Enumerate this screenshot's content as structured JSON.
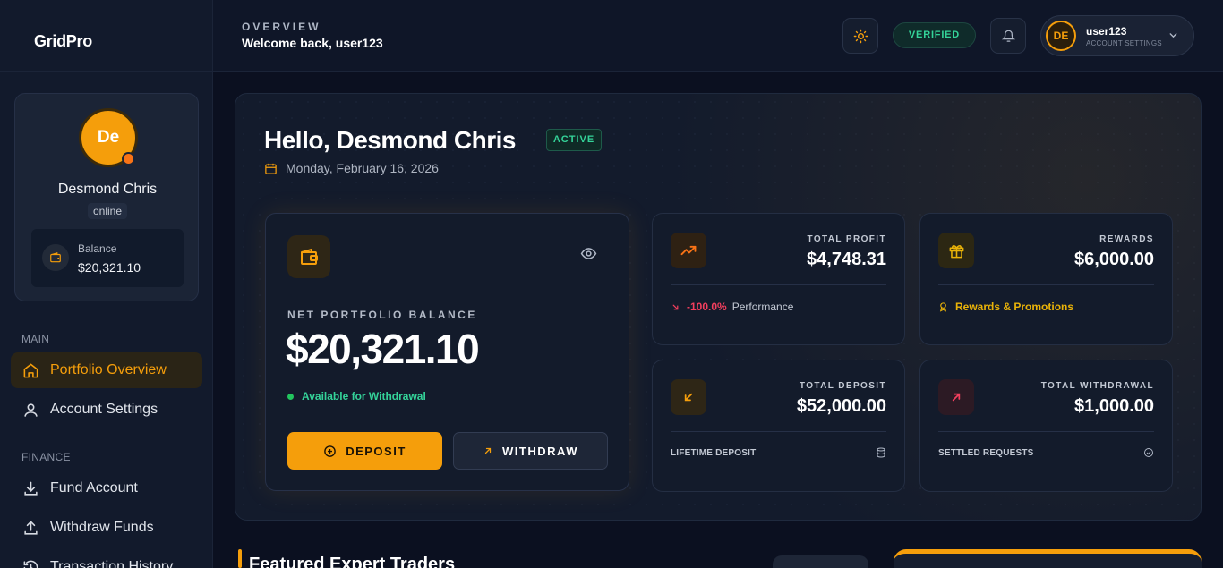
{
  "app": {
    "logo": "GridPro"
  },
  "header": {
    "kicker": "OVERVIEW",
    "welcome": "Welcome back, user123",
    "verified_label": "VERIFIED",
    "user": {
      "initials": "DE",
      "name": "user123",
      "subtitle": "ACCOUNT SETTINGS"
    }
  },
  "sidebar": {
    "profile": {
      "initials": "De",
      "name": "Desmond Chris",
      "status": "online",
      "balance_label": "Balance",
      "balance_value": "$20,321.10"
    },
    "sections": [
      {
        "label": "MAIN",
        "items": [
          {
            "label": "Portfolio Overview",
            "icon": "home-icon",
            "active": true
          },
          {
            "label": "Account Settings",
            "icon": "user-icon",
            "active": false
          }
        ]
      },
      {
        "label": "FINANCE",
        "items": [
          {
            "label": "Fund Account",
            "icon": "download-icon",
            "active": false
          },
          {
            "label": "Withdraw Funds",
            "icon": "upload-icon",
            "active": false
          },
          {
            "label": "Transaction History",
            "icon": "history-icon",
            "active": false
          }
        ]
      }
    ]
  },
  "hero": {
    "greeting": "Hello, Desmond Chris",
    "status_badge": "ACTIVE",
    "date": "Monday, February 16, 2026",
    "balance_card": {
      "label": "NET PORTFOLIO BALANCE",
      "value": "$20,321.10",
      "availability": "Available for Withdrawal",
      "deposit_label": "DEPOSIT",
      "withdraw_label": "WITHDRAW"
    },
    "stats": {
      "profit": {
        "label": "TOTAL PROFIT",
        "value": "$4,748.31",
        "change": "-100.0%",
        "change_label": "Performance"
      },
      "rewards": {
        "label": "REWARDS",
        "value": "$6,000.00",
        "link": "Rewards & Promotions"
      },
      "deposit": {
        "label": "TOTAL DEPOSIT",
        "value": "$52,000.00",
        "foot": "LIFETIME DEPOSIT"
      },
      "withdrawal": {
        "label": "TOTAL WITHDRAWAL",
        "value": "$1,000.00",
        "foot": "SETTLED REQUESTS"
      }
    }
  },
  "featured": {
    "title": "Featured Expert Traders"
  },
  "colors": {
    "accent": "#f59e0b",
    "success": "#34d399",
    "danger": "#f43f5e",
    "background": "#0b1020"
  }
}
